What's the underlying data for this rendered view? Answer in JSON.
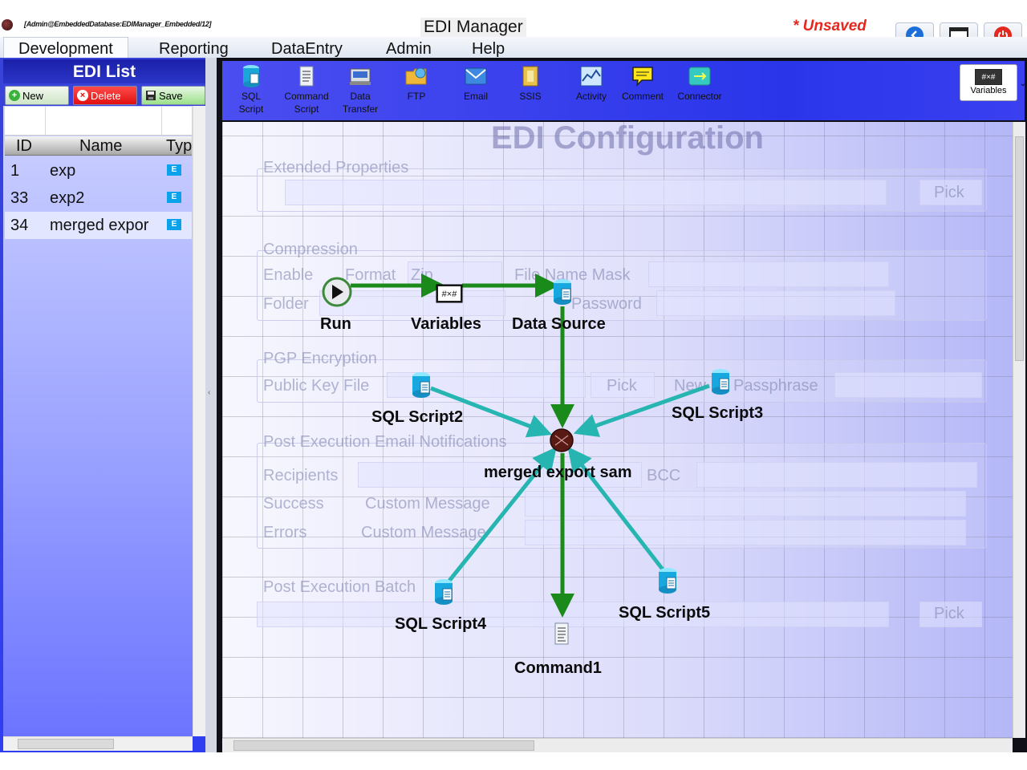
{
  "window": {
    "connection": "[Admin@EmbeddedDatabase:EDIManager_Embedded/12]",
    "title": "EDI Manager",
    "unsaved": "* Unsaved"
  },
  "menu": [
    "Development",
    "Reporting",
    "DataEntry",
    "Admin",
    "Help"
  ],
  "left": {
    "title": "EDI List",
    "buttons": {
      "new": "New",
      "delete": "Delete",
      "save": "Save"
    },
    "columns": {
      "id": "ID",
      "name": "Name",
      "type": "Typ"
    },
    "rows": [
      {
        "id": "1",
        "name": "exp",
        "type": "E"
      },
      {
        "id": "33",
        "name": "exp2",
        "type": "E"
      },
      {
        "id": "34",
        "name": "merged expor",
        "type": "E"
      }
    ]
  },
  "toolbar": {
    "tools": [
      {
        "label1": "SQL",
        "label2": "Script",
        "icon": "database-icon"
      },
      {
        "label1": "Command",
        "label2": "Script",
        "icon": "script-icon"
      },
      {
        "label1": "Data",
        "label2": "Transfer",
        "icon": "data-transfer-icon"
      },
      {
        "label1": "FTP",
        "label2": "",
        "icon": "ftp-folder-icon"
      },
      {
        "label1": "Email",
        "label2": "",
        "icon": "email-icon"
      },
      {
        "label1": "SSIS",
        "label2": "",
        "icon": "ssis-icon"
      },
      {
        "label1": "Activity",
        "label2": "",
        "icon": "activity-icon"
      },
      {
        "label1": "Comment",
        "label2": "",
        "icon": "comment-icon"
      },
      {
        "label1": "Connector",
        "label2": "",
        "icon": "connector-icon"
      }
    ],
    "variables": {
      "label": "Variables",
      "glyph": "#×#"
    }
  },
  "form_ghost": {
    "title": "EDI Configuration",
    "extended": "Extended Properties",
    "pick": "Pick",
    "compression": "Compression",
    "enable": "Enable",
    "format": "Format",
    "format_value": "Zip",
    "file_name_mask": "File Name Mask",
    "folder": "Folder",
    "password": "Password",
    "pgp": "PGP Encryption",
    "public_key": "Public Key File",
    "new": "New",
    "passphrase": "Passphrase",
    "post_email": "Post Execution Email Notifications",
    "recipients": "Recipients",
    "bcc": "BCC",
    "success": "Success",
    "custom_message": "Custom Message",
    "errors": "Errors",
    "post_batch": "Post Execution Batch"
  },
  "flow": {
    "nodes": {
      "run": "Run",
      "variables": "Variables",
      "data_source": "Data Source",
      "sql2": "SQL Script2",
      "sql3": "SQL Script3",
      "hub": "merged export sam",
      "sql4": "SQL Script4",
      "sql5": "SQL Script5",
      "command1": "Command1"
    },
    "colors": {
      "main_link": "#1a8a1a",
      "side_link": "#26b5b0",
      "hub": "#5a1a14"
    }
  }
}
